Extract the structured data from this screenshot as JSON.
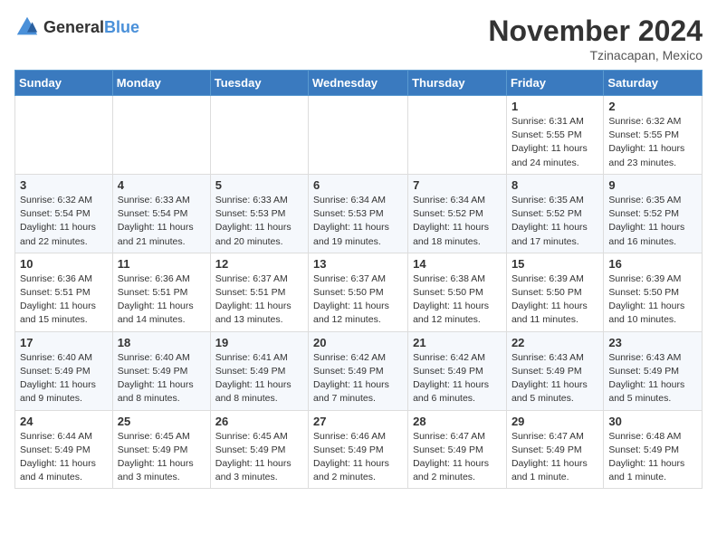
{
  "header": {
    "logo_general": "General",
    "logo_blue": "Blue",
    "month_title": "November 2024",
    "location": "Tzinacapan, Mexico"
  },
  "days_of_week": [
    "Sunday",
    "Monday",
    "Tuesday",
    "Wednesday",
    "Thursday",
    "Friday",
    "Saturday"
  ],
  "weeks": [
    [
      {
        "day": "",
        "info": ""
      },
      {
        "day": "",
        "info": ""
      },
      {
        "day": "",
        "info": ""
      },
      {
        "day": "",
        "info": ""
      },
      {
        "day": "",
        "info": ""
      },
      {
        "day": "1",
        "info": "Sunrise: 6:31 AM\nSunset: 5:55 PM\nDaylight: 11 hours and 24 minutes."
      },
      {
        "day": "2",
        "info": "Sunrise: 6:32 AM\nSunset: 5:55 PM\nDaylight: 11 hours and 23 minutes."
      }
    ],
    [
      {
        "day": "3",
        "info": "Sunrise: 6:32 AM\nSunset: 5:54 PM\nDaylight: 11 hours and 22 minutes."
      },
      {
        "day": "4",
        "info": "Sunrise: 6:33 AM\nSunset: 5:54 PM\nDaylight: 11 hours and 21 minutes."
      },
      {
        "day": "5",
        "info": "Sunrise: 6:33 AM\nSunset: 5:53 PM\nDaylight: 11 hours and 20 minutes."
      },
      {
        "day": "6",
        "info": "Sunrise: 6:34 AM\nSunset: 5:53 PM\nDaylight: 11 hours and 19 minutes."
      },
      {
        "day": "7",
        "info": "Sunrise: 6:34 AM\nSunset: 5:52 PM\nDaylight: 11 hours and 18 minutes."
      },
      {
        "day": "8",
        "info": "Sunrise: 6:35 AM\nSunset: 5:52 PM\nDaylight: 11 hours and 17 minutes."
      },
      {
        "day": "9",
        "info": "Sunrise: 6:35 AM\nSunset: 5:52 PM\nDaylight: 11 hours and 16 minutes."
      }
    ],
    [
      {
        "day": "10",
        "info": "Sunrise: 6:36 AM\nSunset: 5:51 PM\nDaylight: 11 hours and 15 minutes."
      },
      {
        "day": "11",
        "info": "Sunrise: 6:36 AM\nSunset: 5:51 PM\nDaylight: 11 hours and 14 minutes."
      },
      {
        "day": "12",
        "info": "Sunrise: 6:37 AM\nSunset: 5:51 PM\nDaylight: 11 hours and 13 minutes."
      },
      {
        "day": "13",
        "info": "Sunrise: 6:37 AM\nSunset: 5:50 PM\nDaylight: 11 hours and 12 minutes."
      },
      {
        "day": "14",
        "info": "Sunrise: 6:38 AM\nSunset: 5:50 PM\nDaylight: 11 hours and 12 minutes."
      },
      {
        "day": "15",
        "info": "Sunrise: 6:39 AM\nSunset: 5:50 PM\nDaylight: 11 hours and 11 minutes."
      },
      {
        "day": "16",
        "info": "Sunrise: 6:39 AM\nSunset: 5:50 PM\nDaylight: 11 hours and 10 minutes."
      }
    ],
    [
      {
        "day": "17",
        "info": "Sunrise: 6:40 AM\nSunset: 5:49 PM\nDaylight: 11 hours and 9 minutes."
      },
      {
        "day": "18",
        "info": "Sunrise: 6:40 AM\nSunset: 5:49 PM\nDaylight: 11 hours and 8 minutes."
      },
      {
        "day": "19",
        "info": "Sunrise: 6:41 AM\nSunset: 5:49 PM\nDaylight: 11 hours and 8 minutes."
      },
      {
        "day": "20",
        "info": "Sunrise: 6:42 AM\nSunset: 5:49 PM\nDaylight: 11 hours and 7 minutes."
      },
      {
        "day": "21",
        "info": "Sunrise: 6:42 AM\nSunset: 5:49 PM\nDaylight: 11 hours and 6 minutes."
      },
      {
        "day": "22",
        "info": "Sunrise: 6:43 AM\nSunset: 5:49 PM\nDaylight: 11 hours and 5 minutes."
      },
      {
        "day": "23",
        "info": "Sunrise: 6:43 AM\nSunset: 5:49 PM\nDaylight: 11 hours and 5 minutes."
      }
    ],
    [
      {
        "day": "24",
        "info": "Sunrise: 6:44 AM\nSunset: 5:49 PM\nDaylight: 11 hours and 4 minutes."
      },
      {
        "day": "25",
        "info": "Sunrise: 6:45 AM\nSunset: 5:49 PM\nDaylight: 11 hours and 3 minutes."
      },
      {
        "day": "26",
        "info": "Sunrise: 6:45 AM\nSunset: 5:49 PM\nDaylight: 11 hours and 3 minutes."
      },
      {
        "day": "27",
        "info": "Sunrise: 6:46 AM\nSunset: 5:49 PM\nDaylight: 11 hours and 2 minutes."
      },
      {
        "day": "28",
        "info": "Sunrise: 6:47 AM\nSunset: 5:49 PM\nDaylight: 11 hours and 2 minutes."
      },
      {
        "day": "29",
        "info": "Sunrise: 6:47 AM\nSunset: 5:49 PM\nDaylight: 11 hours and 1 minute."
      },
      {
        "day": "30",
        "info": "Sunrise: 6:48 AM\nSunset: 5:49 PM\nDaylight: 11 hours and 1 minute."
      }
    ]
  ]
}
